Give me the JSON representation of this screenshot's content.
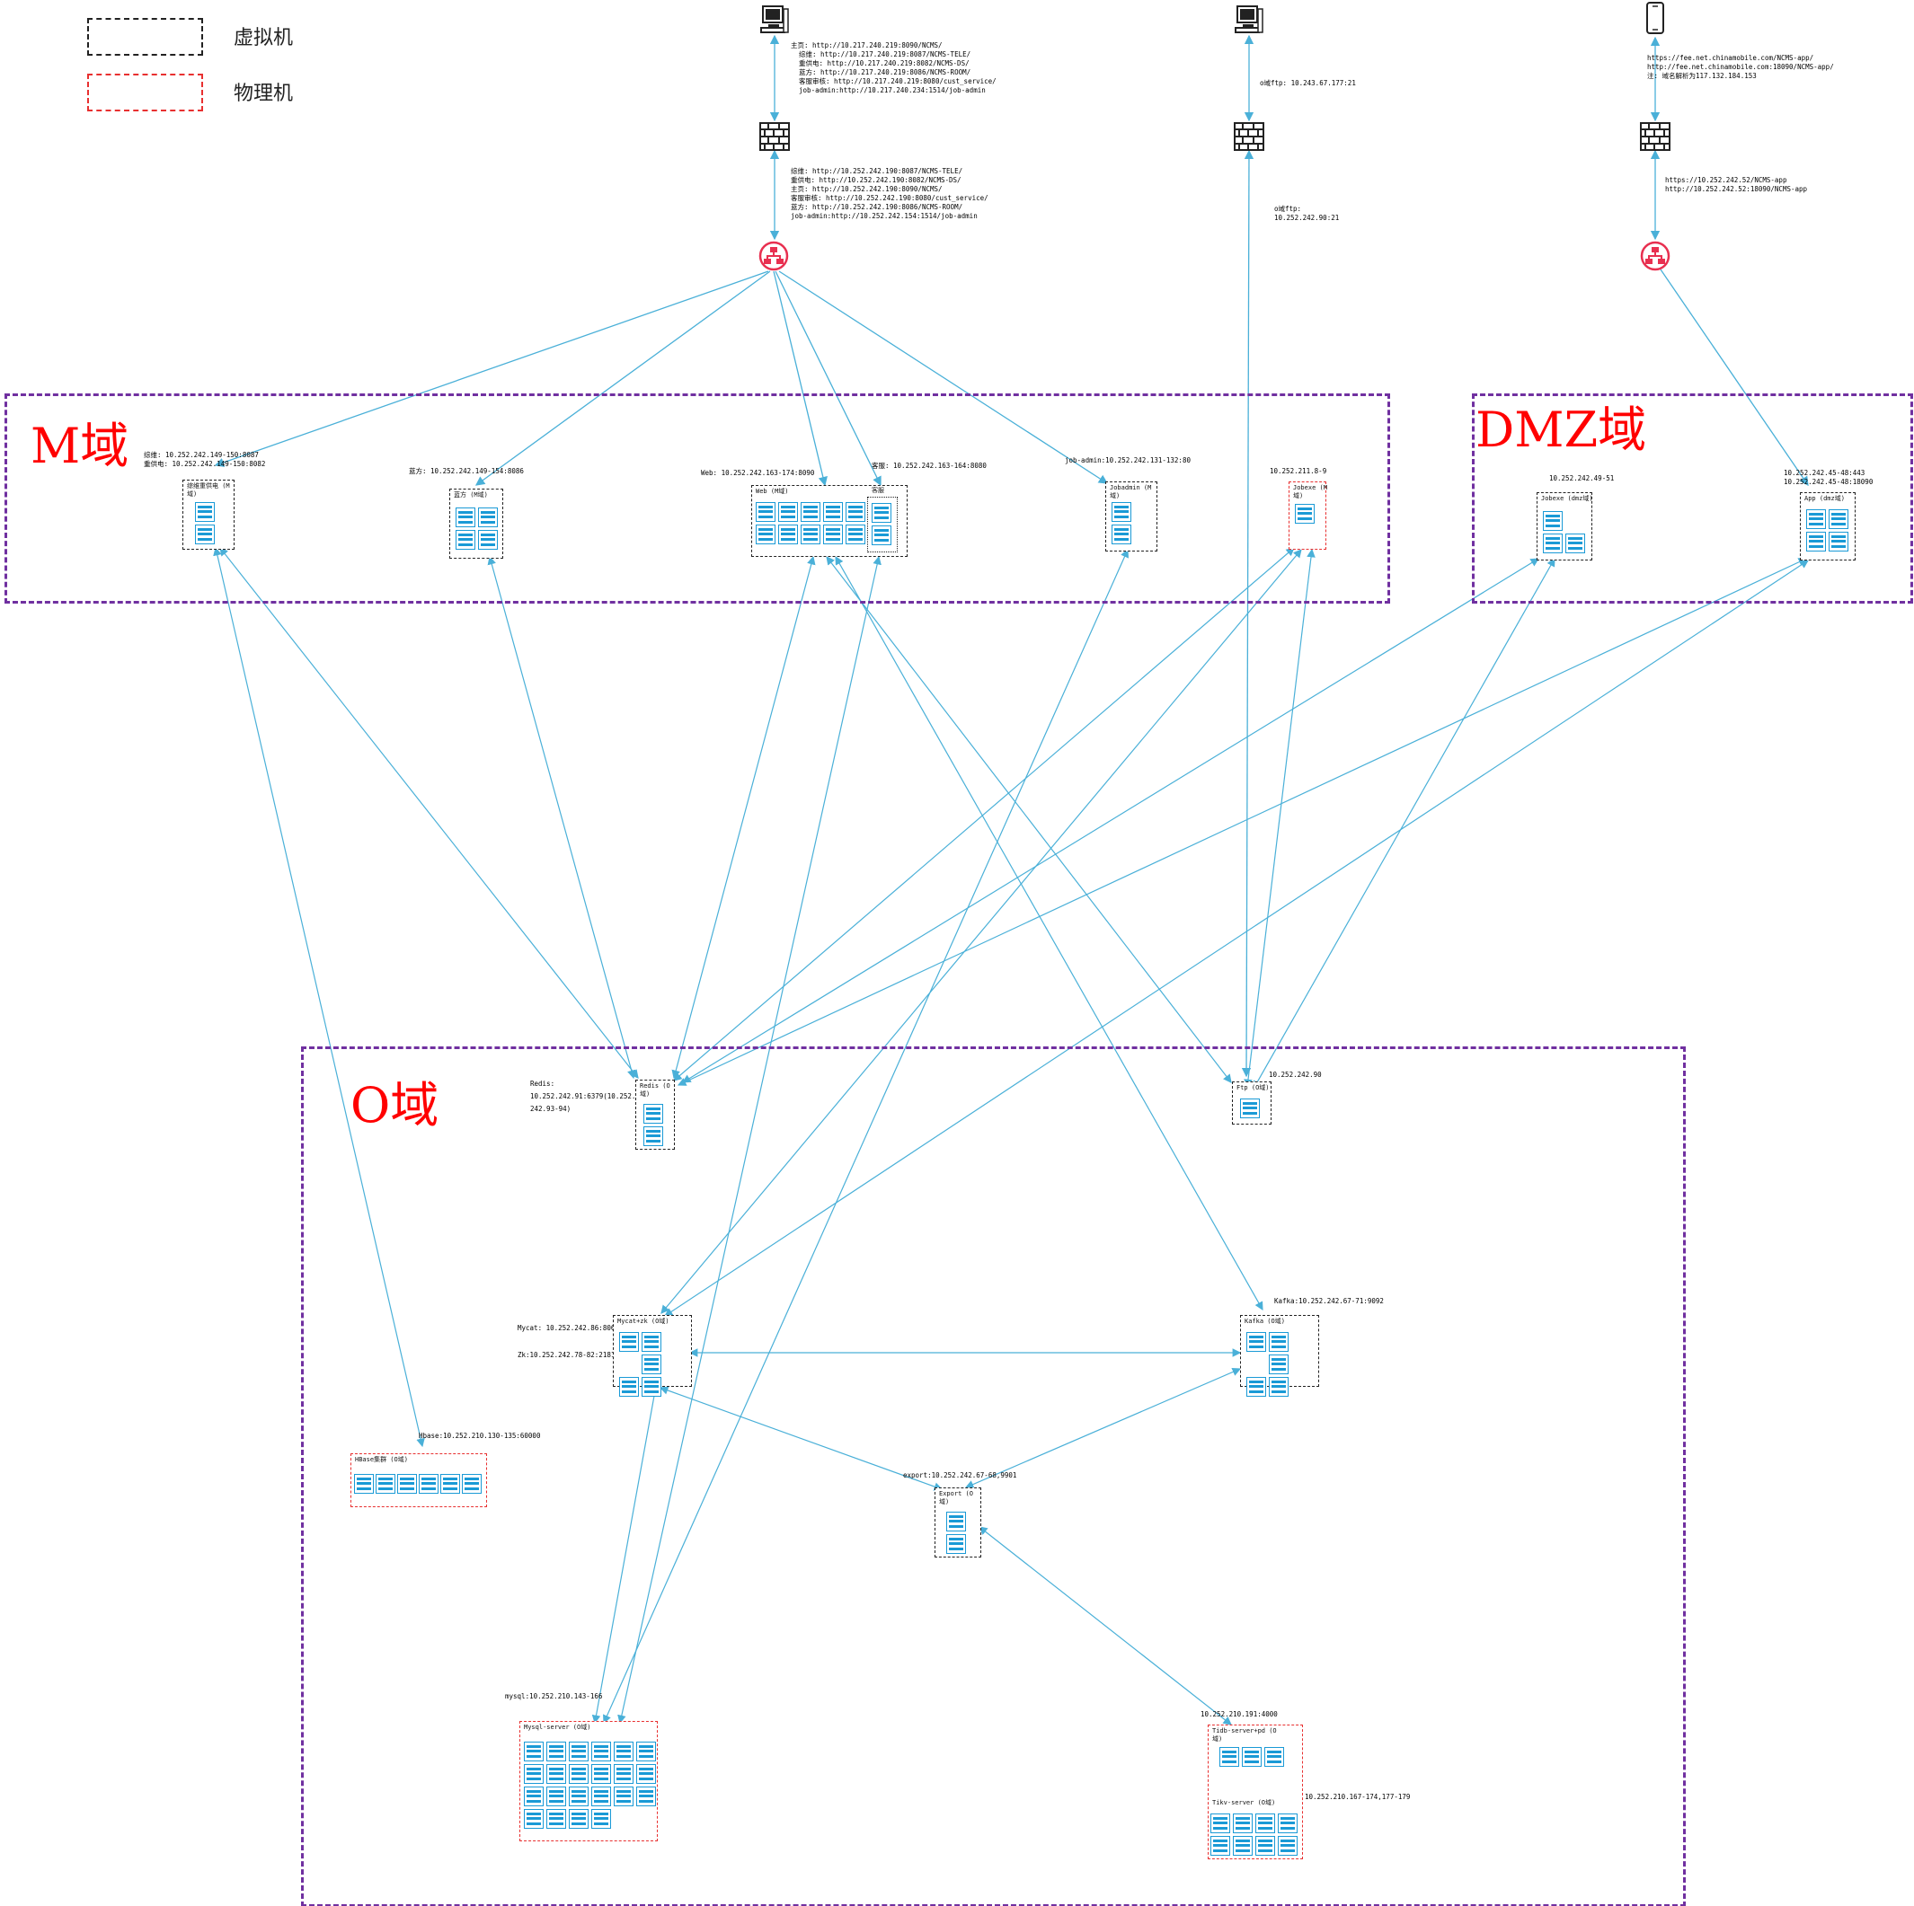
{
  "legend": {
    "virtual_label": "虚拟机",
    "physical_label": "物理机"
  },
  "zones": {
    "m": "M域",
    "dmz": "DMZ域",
    "o": "O域"
  },
  "notes": {
    "top_fw_in": "主页: http://10.217.240.219:8090/NCMS/\n  综维: http://10.217.240.219:8087/NCMS-TELE/\n  重供电: http://10.217.240.219:8082/NCMS-DS/\n  蓝方: http://10.217.240.219:8086/NCMS-ROOM/\n  客服审核: http://10.217.240.219:8080/cust_service/\n  job-admin:http://10.217.240.234:1514/job-admin",
    "top_fw_out": "综维: http://10.252.242.190:8087/NCMS-TELE/\n重供电: http://10.252.242.190:8082/NCMS-DS/\n主页: http://10.252.242.190:8090/NCMS/\n客服审核: http://10.252.242.190:8080/cust_service/\n蓝方: http://10.252.242.190:8086/NCMS-ROOM/\njob-admin:http://10.252.242.154:1514/job-admin",
    "ftp_top": "o域ftp: 10.243.67.177:21",
    "ftp_mid": "o域ftp:\n10.252.242.90:21",
    "app_top": "https://fee.net.chinamobile.com/NCMS-app/\nhttp://fee.net.chinamobile.com:18090/NCMS-app/\n注: 域名解析为117.132.184.153",
    "app_mid": "https://10.252.242.52/NCMS-app\nhttp://10.252.242.52:18090/NCMS-app",
    "m_zonghe": "综维: 10.252.242.149-150:8087\n重供电: 10.252.242.149-150:8082",
    "m_lanfang": "蓝方: 10.252.242.149-154:8086",
    "m_web": "Web: 10.252.242.163-174:8090",
    "m_kefu": "客服: 10.252.242.163-164:8080",
    "m_jobadmin": "job-admin:10.252.242.131-132:80",
    "m_jobexe": "10.252.211.8-9",
    "dmz_jobexe": "10.252.242.49-51",
    "dmz_app": "10.252.242.45-48:443\n10.252.242.45-48:18090",
    "o_redis": "Redis:\n10.252.242.91:6379(10.252.\n242.93-94)",
    "o_ftp": "10.252.242.90",
    "o_kafka": "Kafka:10.252.242.67-71:9092",
    "o_mycat1": "Mycat: 10.252.242.86:8066",
    "o_mycat2": "Zk:10.252.242.78-82:2181",
    "o_hbase": "Hbase:10.252.210.130-135:60000",
    "o_export": "export:10.252.242.67-68,9901",
    "o_mysql": "mysql:10.252.210.143-166",
    "o_tidb_pd": "10.252.210.191:4000",
    "o_tikv": "10.252.210.167-174,177-179"
  },
  "servers": {
    "zonghe": "综维重供电 (M\n域)",
    "lanfang": "蓝方 (M域)",
    "web": "Web (M域)",
    "kefu": "客服",
    "jobadmin": "Jobadmin (M\n域)",
    "jobexe_m": "Jobexe (M\n域)",
    "jobexe_dmz": "Jobexe (dmz域)",
    "app": "App (dmz域)",
    "redis": "Redis (O\n域)",
    "ftp": "Ftp (O域)",
    "mycat": "Mycat+zk (O域)",
    "kafka": "Kafka (O域)",
    "hbase": "HBase集群 (O域)",
    "export": "Export (O\n域)",
    "mysql": "Mysql-server (O域)",
    "tidb": "Tidb-server+pd (O\n域)",
    "tikv": "Tikv-server (O域)"
  },
  "colors": {
    "virtual": "#222222",
    "physical": "#e83030",
    "zone_border": "#7030a0",
    "zone_title": "#ff0000",
    "link": "#4ab0d8",
    "icon": "#1a9ad6"
  },
  "icons": [
    "computer-icon",
    "mobile-phone-icon",
    "firewall-icon",
    "router-icon",
    "server-rack-icon"
  ]
}
